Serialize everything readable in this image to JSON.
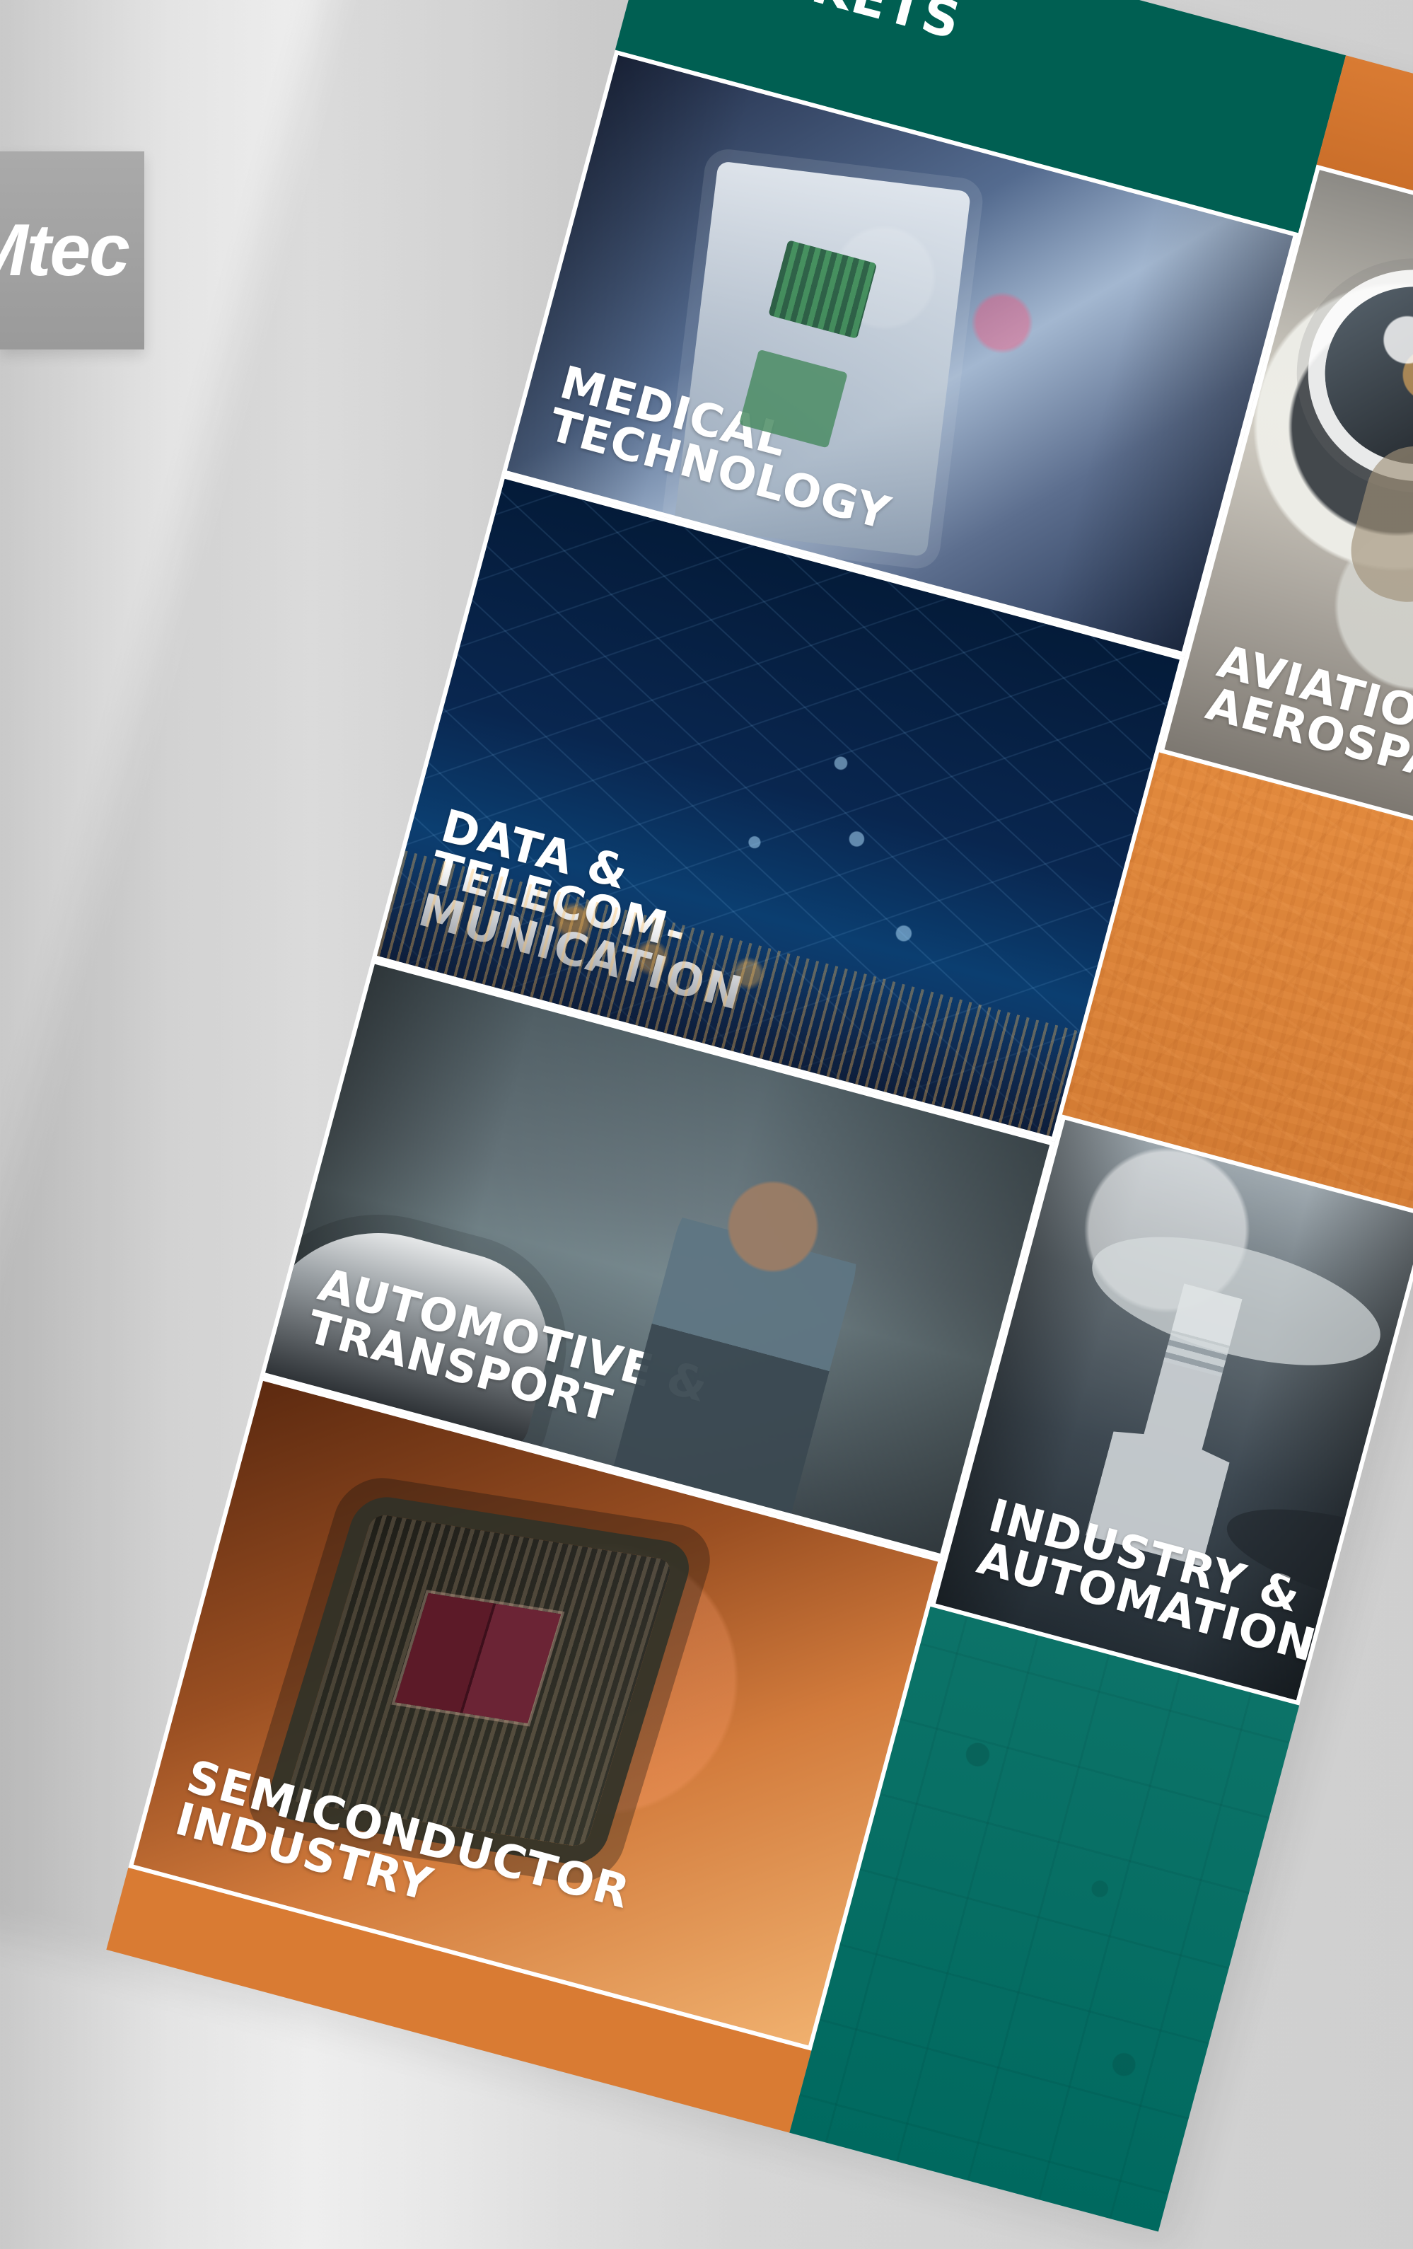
{
  "brand": {
    "logo_text": "Mtec"
  },
  "brochure": {
    "header_title": "MARKETS",
    "tiles": {
      "medical": [
        "MEDICAL",
        "TECHNOLOGY"
      ],
      "data_telecom": [
        "DATA &",
        "TELECOM-",
        "MUNICATION"
      ],
      "automotive": [
        "AUTOMOTIVE &",
        "TRANSPORT"
      ],
      "semiconductor": [
        "SEMICONDUCTOR",
        "INDUSTRY"
      ],
      "aviation": [
        "AVIATION &",
        "AEROSPACE"
      ],
      "industry": [
        "INDUSTRY &",
        "AUTOMATION"
      ]
    }
  },
  "colors": {
    "teal": "#005f52",
    "orange": "#d97b33",
    "background": "#e6e6e6",
    "logo_card": "#a3a3a3",
    "text": "#ffffff"
  }
}
